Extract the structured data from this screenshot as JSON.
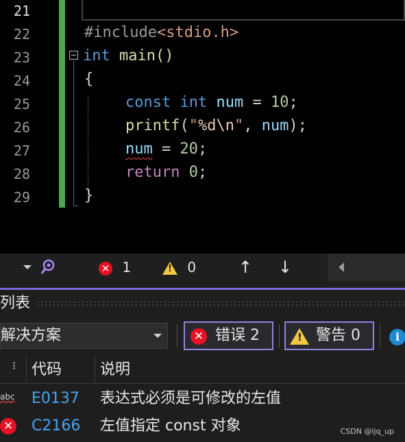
{
  "editor": {
    "line_numbers": [
      "21",
      "22",
      "23",
      "24",
      "25",
      "26",
      "27",
      "28",
      "29"
    ],
    "lines": {
      "l22_pre": "#include",
      "l22_inc": "<stdio.h>",
      "l23_kw": "int",
      "l23_fn": " main()",
      "l24": "{",
      "l25_kw1": "const",
      "l25_kw2": "int",
      "l25_id": "num",
      "l25_op": " = ",
      "l25_num": "10",
      "l25_end": ";",
      "l26_fn": "printf",
      "l26_p1": "(",
      "l26_str1": "\"",
      "l26_fmt": "%d",
      "l26_esc": "\\n",
      "l26_str2": "\"",
      "l26_comma": ", ",
      "l26_id": "num",
      "l26_end": ");",
      "l27_id": "num",
      "l27_op": " = ",
      "l27_num": "20",
      "l27_end": ";",
      "l28_kw": "return",
      "l28_num": "0",
      "l28_end": ";",
      "l29": "}"
    }
  },
  "statusbar": {
    "error_count": "1",
    "warning_count": "0",
    "up_arrow": "↑",
    "down_arrow": "↓"
  },
  "error_list": {
    "title": "列表",
    "scope": "解决方案",
    "errors_button": "错误 2",
    "warnings_button": "警告 0",
    "columns": {
      "code": "代码",
      "description": "说明"
    },
    "rows": [
      {
        "icon": "abc",
        "code": "E0137",
        "description": "表达式必须是可修改的左值"
      },
      {
        "icon": "error",
        "code": "C2166",
        "description": "左值指定 const 对象"
      }
    ]
  },
  "watermark": "CSDN @ljq_up",
  "colors": {
    "accent": "#7a68d6",
    "error": "#e81123",
    "warning": "#f2c744",
    "green_bar": "#4ca64c"
  }
}
